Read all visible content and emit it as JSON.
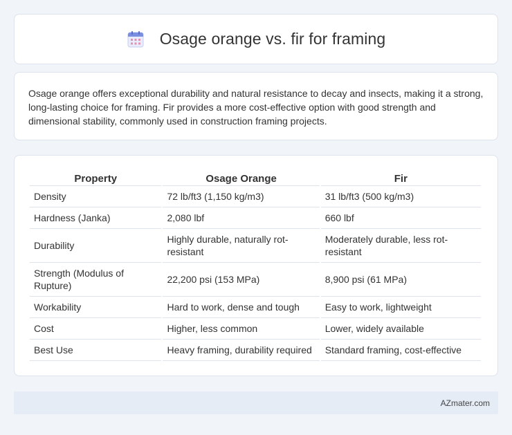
{
  "header": {
    "title": "Osage orange vs. fir for framing",
    "icon": "calendar-icon"
  },
  "description": "Osage orange offers exceptional durability and natural resistance to decay and insects, making it a strong, long-lasting choice for framing. Fir provides a more cost-effective option with good strength and dimensional stability, commonly used in construction framing projects.",
  "table": {
    "headers": [
      "Property",
      "Osage Orange",
      "Fir"
    ],
    "rows": [
      [
        "Density",
        "72 lb/ft3 (1,150 kg/m3)",
        "31 lb/ft3 (500 kg/m3)"
      ],
      [
        "Hardness (Janka)",
        "2,080 lbf",
        "660 lbf"
      ],
      [
        "Durability",
        "Highly durable, naturally rot-resistant",
        "Moderately durable, less rot-resistant"
      ],
      [
        "Strength (Modulus of Rupture)",
        "22,200 psi (153 MPa)",
        "8,900 psi (61 MPa)"
      ],
      [
        "Workability",
        "Hard to work, dense and tough",
        "Easy to work, lightweight"
      ],
      [
        "Cost",
        "Higher, less common",
        "Lower, widely available"
      ],
      [
        "Best Use",
        "Heavy framing, durability required",
        "Standard framing, cost-effective"
      ]
    ]
  },
  "footer": {
    "brand": "AZmater.com"
  },
  "colors": {
    "background": "#f1f4f9",
    "card": "#ffffff",
    "border": "#dde3ec",
    "footer_bg": "#e6ecf6",
    "icon_accent": "#7b8fe0"
  }
}
